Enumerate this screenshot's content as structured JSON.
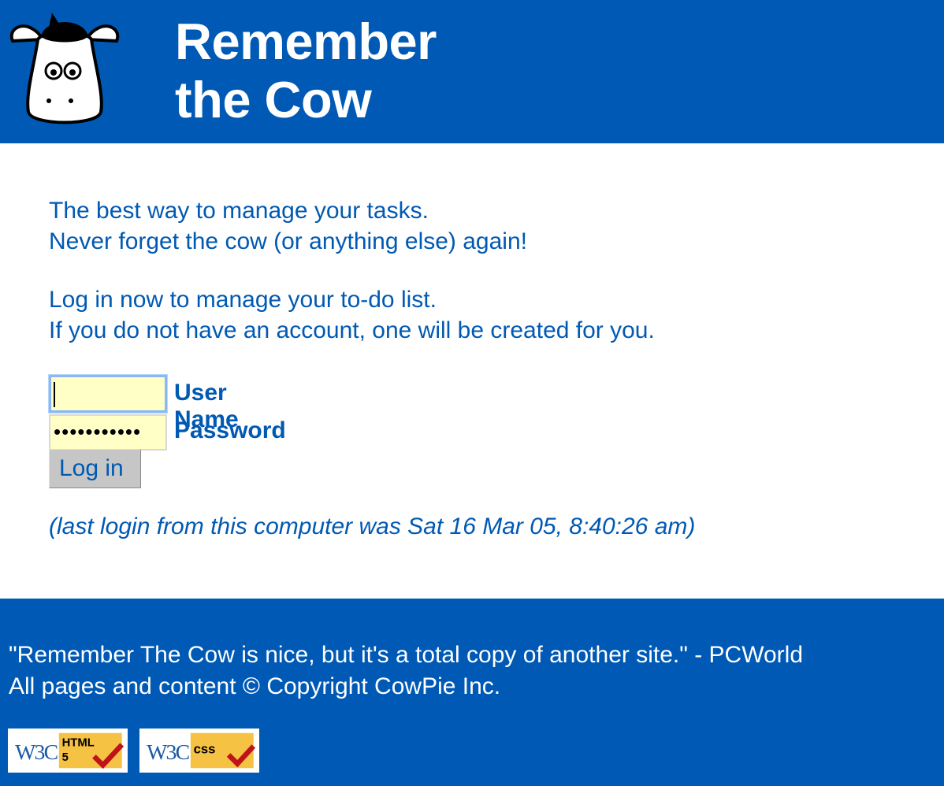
{
  "header": {
    "title_line1": "Remember",
    "title_line2": "the Cow",
    "logo": "cow-face-logo"
  },
  "intro": {
    "line1": "The best way to manage your tasks.",
    "line2": "Never forget the cow (or anything else) again!"
  },
  "cta": {
    "line1": "Log in now to manage your to-do list.",
    "line2": "If you do not have an account, one will be created for you."
  },
  "form": {
    "username_label": "User Name",
    "username_value": "",
    "password_label": "Password",
    "password_value": "•••••••••••",
    "login_button": "Log in"
  },
  "last_login": "(last login from this computer was Sat 16 Mar 05, 8:40:26 am)",
  "footer": {
    "quote": "\"Remember The Cow is nice, but it's a total copy of another site.\" - PCWorld",
    "copyright": "All pages and content © Copyright CowPie Inc.",
    "badges": [
      {
        "w3c": "W3C",
        "label_top": "HTML",
        "label_bottom": "5"
      },
      {
        "w3c": "W3C",
        "label_top": "css",
        "label_bottom": ""
      }
    ]
  },
  "colors": {
    "brand_blue": "#005ab5",
    "text_blue": "#0059b3",
    "input_yellow": "#ffffc6",
    "badge_yellow": "#f6c244",
    "check_red": "#c0121a"
  }
}
